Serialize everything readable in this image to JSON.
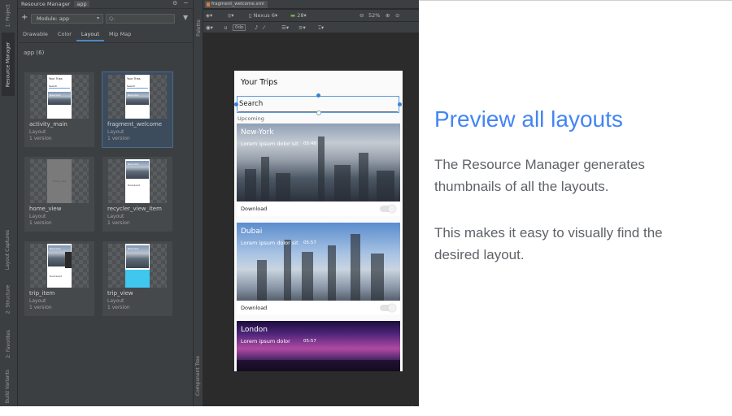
{
  "tool_windows": {
    "left": [
      "1: Project",
      "Resource Manager",
      "Layout Captures",
      "2: Structure",
      "2: Favorites",
      "Build Variants"
    ],
    "palette": "Palette",
    "component_tree": "Component Tree"
  },
  "resource_manager": {
    "title": "Resource Manager",
    "app_tab": "app",
    "module_label": "Module: app",
    "search_placeholder": "Q-",
    "tabs": [
      "Drawable",
      "Color",
      "Layout",
      "Mip Map"
    ],
    "selected_tab": "Layout",
    "group_label": "app (6)",
    "items": [
      {
        "name": "activity_main",
        "type": "Layout",
        "versions": "1 version"
      },
      {
        "name": "fragment_welcome",
        "type": "Layout",
        "versions": "1 version"
      },
      {
        "name": "home_view",
        "type": "Layout",
        "versions": "1 version"
      },
      {
        "name": "recycler_view_item",
        "type": "Layout",
        "versions": "1 version"
      },
      {
        "name": "trip_item",
        "type": "Layout",
        "versions": "1 version"
      },
      {
        "name": "trip_view",
        "type": "Layout",
        "versions": "1 version"
      }
    ],
    "mini_thumb": {
      "title": "Your Trips",
      "search": "Search",
      "city": "New-York",
      "download": "Download",
      "home_label": "Home view"
    }
  },
  "editor": {
    "file_tab": "fragment_welcome.xml",
    "device": "Nexus 6",
    "api": "28",
    "zoom": "52%",
    "margin": "0dp"
  },
  "preview": {
    "title": "Your Trips",
    "search": "Search",
    "section": "Upcoming",
    "trips": [
      {
        "city": "New-York",
        "subtitle": "Lorem ipsum dolor sit",
        "time": "05:48",
        "action": "Download"
      },
      {
        "city": "Dubai",
        "subtitle": "Lorem ipsum dolor sit",
        "time": "05:57",
        "action": "Download"
      },
      {
        "city": "London",
        "subtitle": "Lorem ipsum dolor",
        "time": "05:57",
        "action": ""
      }
    ]
  },
  "slide": {
    "title": "Preview all layouts",
    "paragraph1": "The Resource Manager generates thumbnails of all the layouts.",
    "paragraph2": "This makes it easy to visually find the desired layout."
  },
  "colors": {
    "ide_background": "#2b2b2b",
    "panel": "#3c3f41",
    "selection": "#4a88c7",
    "slide_title": "#4285f4",
    "slide_text": "#5f6368"
  }
}
